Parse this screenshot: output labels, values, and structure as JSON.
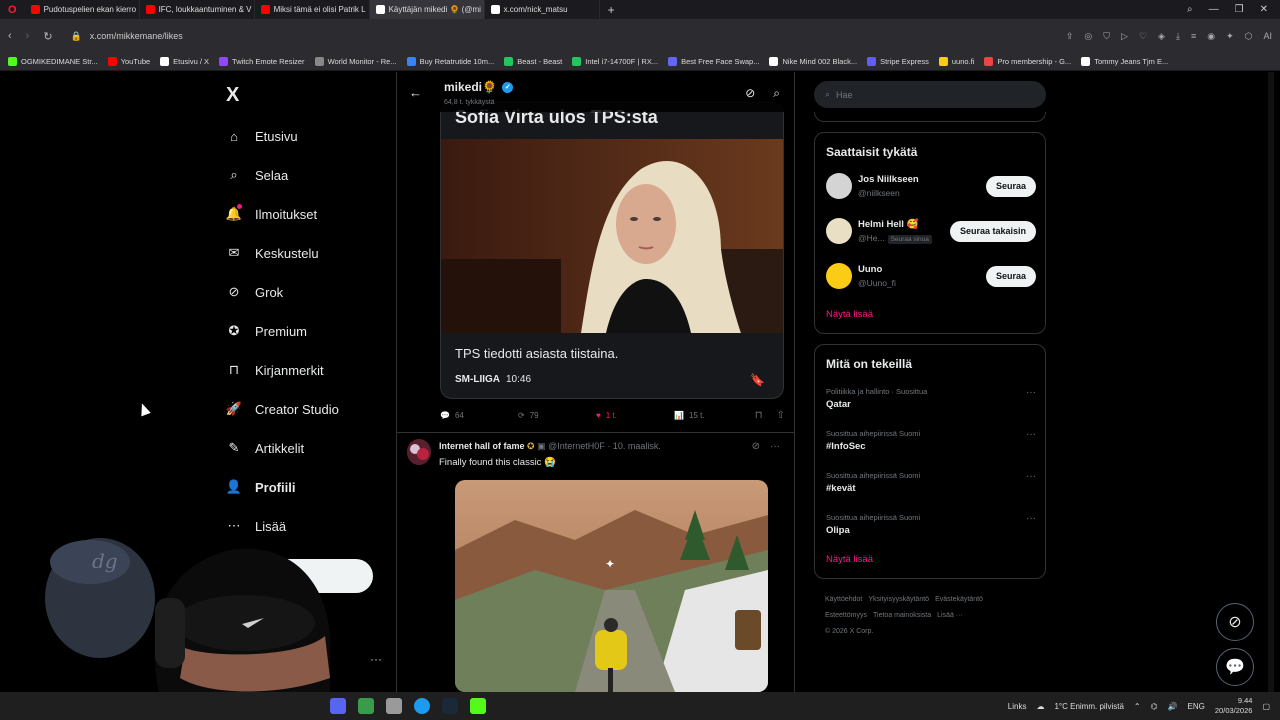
{
  "browser": {
    "tabs": [
      {
        "label": "Pudotuspelien ekan kierro",
        "color": "#ff0000",
        "active": false
      },
      {
        "label": "IFC, loukkaantuminen & V",
        "color": "#ff0000",
        "active": false
      },
      {
        "label": "Miksi tämä ei olisi Patrik L",
        "color": "#ff0000",
        "active": false
      },
      {
        "label": "Käyttäjän mikedi 🌻 (@mi",
        "color": "#ffffff",
        "active": true
      },
      {
        "label": "x.com/nick_matsu",
        "color": "#ffffff",
        "active": false
      }
    ],
    "url": "x.com/mikkemane/likes",
    "bookmarks": [
      {
        "label": "OGMIKEDIMANE Str...",
        "color": "#53fc18"
      },
      {
        "label": "YouTube",
        "color": "#ff0000"
      },
      {
        "label": "Etusivu / X",
        "color": "#ffffff"
      },
      {
        "label": "Twitch Emote Resizer",
        "color": "#9146ff"
      },
      {
        "label": "World Monitor - Re...",
        "color": "#888888"
      },
      {
        "label": "Buy Retatrutide 10m...",
        "color": "#3b82f6"
      },
      {
        "label": "Beast - Beast",
        "color": "#22c55e"
      },
      {
        "label": "Intel i7-14700F | RX...",
        "color": "#22c55e"
      },
      {
        "label": "Best Free Face Swap...",
        "color": "#6366f1"
      },
      {
        "label": "Nike Mind 002 Black...",
        "color": "#ffffff"
      },
      {
        "label": "Stripe Express",
        "color": "#635bff"
      },
      {
        "label": "uuno.fi",
        "color": "#facc15"
      },
      {
        "label": "Pro membership - G...",
        "color": "#ef4444"
      },
      {
        "label": "Tommy Jeans Tjm E...",
        "color": "#ffffff"
      }
    ]
  },
  "nav": {
    "logo": "X",
    "items": [
      {
        "label": "Etusivu",
        "icon": "home-icon",
        "glyph": "⌂"
      },
      {
        "label": "Selaa",
        "icon": "search-icon",
        "glyph": "⌕"
      },
      {
        "label": "Ilmoitukset",
        "icon": "bell-icon",
        "glyph": "🔔"
      },
      {
        "label": "Keskustelu",
        "icon": "mail-icon",
        "glyph": "✉"
      },
      {
        "label": "Grok",
        "icon": "grok-icon",
        "glyph": "⊘"
      },
      {
        "label": "Premium",
        "icon": "premium-icon",
        "glyph": "✪"
      },
      {
        "label": "Kirjanmerkit",
        "icon": "bookmark-icon",
        "glyph": "⊓"
      },
      {
        "label": "Creator Studio",
        "icon": "rocket-icon",
        "glyph": "🚀"
      },
      {
        "label": "Artikkelit",
        "icon": "article-icon",
        "glyph": "✎"
      },
      {
        "label": "Profiili",
        "icon": "profile-icon",
        "glyph": "👤"
      },
      {
        "label": "Lisää",
        "icon": "more-icon",
        "glyph": "⋯"
      }
    ]
  },
  "header": {
    "name": "mikedi",
    "emoji": "🌻",
    "likes": "64,8 t. tykkäystä"
  },
  "post1": {
    "card_title": "Sofia Virta ulos TPS:sta",
    "card_text": "TPS tiedotti asiasta tiistaina.",
    "card_source": "SM-LIIGA",
    "card_time": "10:46",
    "replies": "64",
    "reposts": "79",
    "likes": "1 t.",
    "views": "15 t."
  },
  "post2": {
    "author": "Internet hall of fame",
    "handle": "@InternetH0F",
    "date": "· 10. maalisk.",
    "text": "Finally found this classic 😭"
  },
  "sidebar": {
    "search_placeholder": "Hae",
    "who_to_follow_title": "Saattaisit tykätä",
    "suggestions": [
      {
        "name": "Jos Niilkseen",
        "handle": "@niilkseen",
        "button": "Seuraa",
        "follows_you": "",
        "avatar": "#d4d4d4"
      },
      {
        "name": "Helmi Hell 🥰",
        "handle": "@He...",
        "button": "Seuraa takaisin",
        "follows_you": "Seuraa sinua",
        "avatar": "#e8dfc4"
      },
      {
        "name": "Uuno",
        "handle": "@Uuno_fi",
        "button": "Seuraa",
        "follows_you": "",
        "avatar": "#facc15"
      }
    ],
    "show_more": "Näytä lisää",
    "trends_title": "Mitä on tekeillä",
    "trends": [
      {
        "meta": "Politiikka ja hallinto · Suosittua",
        "name": "Qatar"
      },
      {
        "meta": "Suosittua aihepiirissä Suomi",
        "name": "#InfoSec"
      },
      {
        "meta": "Suosittua aihepiirissä Suomi",
        "name": "#kevät"
      },
      {
        "meta": "Suosittua aihepiirissä Suomi",
        "name": "Olipa"
      }
    ],
    "trends_show_more": "Näytä lisää",
    "footer": [
      "Käyttöehdot",
      "Yksityisyyskäytäntö",
      "Evästekäytäntö",
      "Esteettömyys",
      "Tietoa mainoksista",
      "Lisää ···",
      "© 2026 X Corp."
    ]
  },
  "taskbar": {
    "links": "Links",
    "weather": "1°C  Enimm. pilvistä",
    "lang": "ENG",
    "time": "9.44",
    "date": "20/03/2026"
  }
}
